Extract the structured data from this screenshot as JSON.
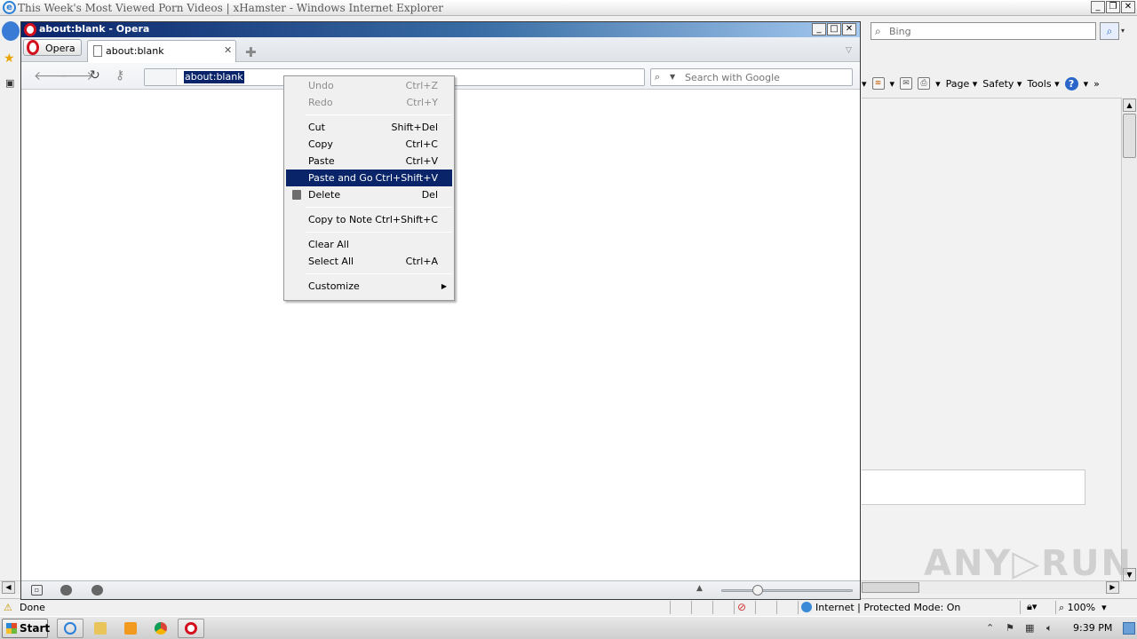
{
  "ie": {
    "title": "This Week's Most Viewed Porn Videos | xHamster - Windows Internet Explorer",
    "search_placeholder": "Bing",
    "cmd": {
      "page": "Page ▾",
      "safety": "Safety ▾",
      "tools": "Tools ▾",
      "help": "?"
    },
    "status": {
      "done": "Done",
      "zone": "Internet | Protected Mode: On",
      "zoom": "100%"
    }
  },
  "opera": {
    "title": "about:blank - Opera",
    "menu_label": "Opera",
    "tab_label": "about:blank",
    "address": "about:blank",
    "search_placeholder": "Search with Google"
  },
  "context_menu": {
    "items": [
      {
        "label": "Undo",
        "shortcut": "Ctrl+Z"
      },
      {
        "label": "Redo",
        "shortcut": "Ctrl+Y"
      },
      {
        "label": "Cut",
        "shortcut": "Shift+Del"
      },
      {
        "label": "Copy",
        "shortcut": "Ctrl+C"
      },
      {
        "label": "Paste",
        "shortcut": "Ctrl+V"
      },
      {
        "label": "Paste and Go",
        "shortcut": "Ctrl+Shift+V"
      },
      {
        "label": "Delete",
        "shortcut": "Del"
      },
      {
        "label": "Copy to Note",
        "shortcut": "Ctrl+Shift+C"
      },
      {
        "label": "Clear All",
        "shortcut": ""
      },
      {
        "label": "Select All",
        "shortcut": "Ctrl+A"
      },
      {
        "label": "Customize",
        "shortcut": ""
      }
    ]
  },
  "taskbar": {
    "start": "Start",
    "time": "9:39 PM"
  },
  "watermark": "ANY▷RUN",
  "colors": {
    "highlight": "#0a246a",
    "opera_red": "#d4101e"
  }
}
